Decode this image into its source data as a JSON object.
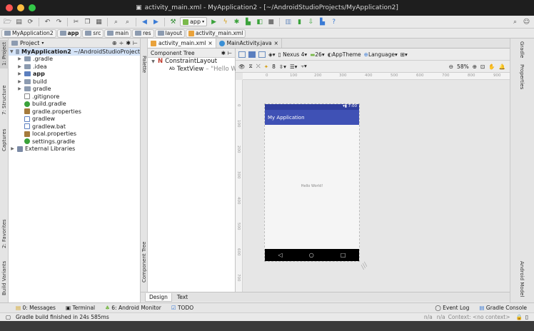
{
  "window": {
    "title": "activity_main.xml - MyApplication2 - [~/AndroidStudioProjects/MyApplication2]"
  },
  "toolbar": {
    "run_config": "app"
  },
  "breadcrumbs": [
    "MyApplication2",
    "app",
    "src",
    "main",
    "res",
    "layout",
    "activity_main.xml"
  ],
  "left_tools": {
    "project": "1: Project",
    "structure": "7: Structure",
    "captures": "Captures",
    "favorites": "2: Favorites",
    "build_variants": "Build Variants"
  },
  "project_panel": {
    "view_mode": "Project",
    "root": {
      "name": "MyApplication2",
      "path": "~/AndroidStudioProject"
    },
    "items": [
      ".gradle",
      ".idea",
      "app",
      "build",
      "gradle",
      ".gitignore",
      "build.gradle",
      "gradle.properties",
      "gradlew",
      "gradlew.bat",
      "local.properties",
      "settings.gradle"
    ],
    "external": "External Libraries"
  },
  "palette_label": "Palette",
  "editor_tabs": [
    "activity_main.xml",
    "MainActivity.java"
  ],
  "component_tree": {
    "title": "Component Tree",
    "root": "ConstraintLayout",
    "child": "TextView",
    "child_text": "– \"Hello Wo",
    "side_label": "Component Tree"
  },
  "design_toolbar": {
    "device": "Nexus 4",
    "api": "26",
    "theme": "AppTheme",
    "language": "Language",
    "margin": "8",
    "zoom": "58%"
  },
  "ruler": {
    "h": [
      "0",
      "100",
      "200",
      "300",
      "400",
      "500",
      "600",
      "700",
      "800",
      "900"
    ],
    "v": [
      "0",
      "100",
      "200",
      "300",
      "400",
      "500",
      "600",
      "700"
    ]
  },
  "phone": {
    "time": "7:00",
    "app_title": "My Application",
    "text": "Hello World!",
    "colors": {
      "appbar": "#3f51b5",
      "statusbar": "#303f9f"
    }
  },
  "right_tools": {
    "gradle": "Gradle",
    "properties": "Properties",
    "android_model": "Android Model"
  },
  "bottom_tabs": [
    "Design",
    "Text"
  ],
  "tool_windows": {
    "messages": "0: Messages",
    "terminal": "Terminal",
    "monitor": "6: Android Monitor",
    "todo": "TODO",
    "event_log": "Event Log",
    "gradle_console": "Gradle Console"
  },
  "status": {
    "message": "Gradle build finished in 24s 585ms",
    "pos": "n/a",
    "pos2": "n/a",
    "context": "Context: <no context>"
  }
}
